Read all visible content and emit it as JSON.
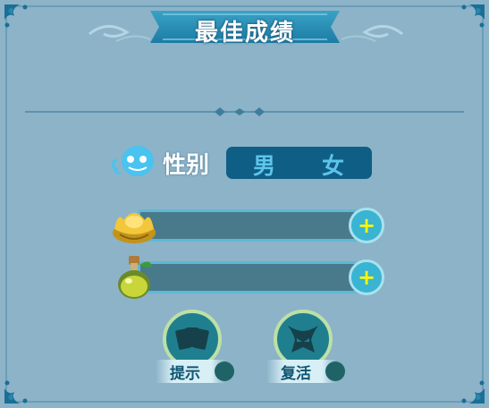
{
  "title": "最佳成绩",
  "gender": {
    "label": "性别",
    "male": "男",
    "female": "女"
  },
  "resources": [
    {
      "icon": "gold-ingot-icon",
      "add_label": "+"
    },
    {
      "icon": "potion-flask-icon",
      "add_label": "+"
    }
  ],
  "actions": {
    "hint_label": "提示",
    "revive_label": "复活"
  },
  "colors": {
    "background": "#8cb3c8",
    "banner": "#2f8fb3",
    "gender_box": "#0f5e86",
    "plus_button": "#39b4d3",
    "plus_sign": "#fff700"
  }
}
